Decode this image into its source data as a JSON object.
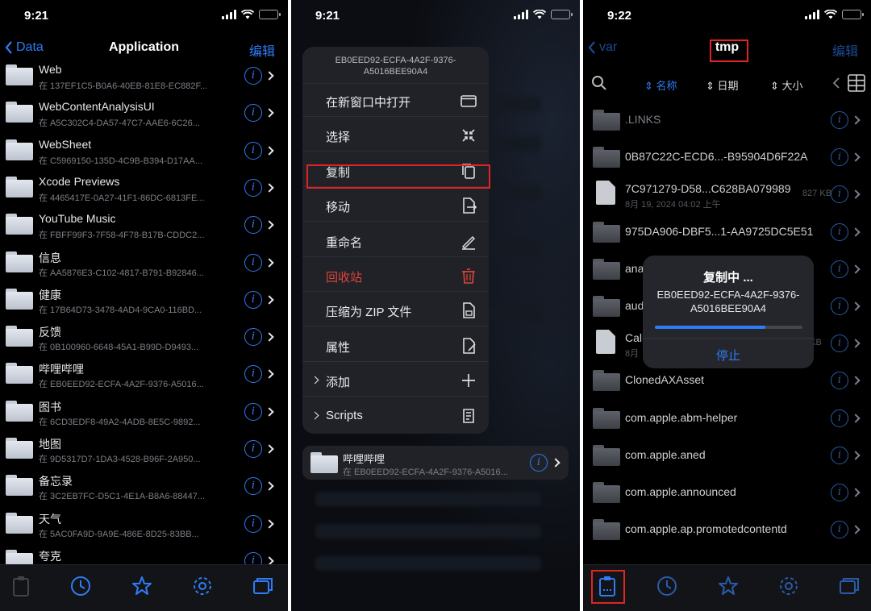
{
  "panel1": {
    "status": {
      "time": "9:21"
    },
    "nav": {
      "back_label": "Data",
      "title": "Application",
      "edit_label": "编辑"
    },
    "rows": [
      {
        "name": "Web",
        "sub": "在 137EF1C5-B0A6-40EB-81E8-EC882F..."
      },
      {
        "name": "WebContentAnalysisUI",
        "sub": "在 A5C302C4-DA57-47C7-AAE6-6C26..."
      },
      {
        "name": "WebSheet",
        "sub": "在 C5969150-135D-4C9B-B394-D17AA..."
      },
      {
        "name": "Xcode Previews",
        "sub": "在 4465417E-0A27-41F1-86DC-6813FE..."
      },
      {
        "name": "YouTube Music",
        "sub": "在 FBFF99F3-7F58-4F78-B17B-CDDC2..."
      },
      {
        "name": "信息",
        "sub": "在 AA5876E3-C102-4817-B791-B92846..."
      },
      {
        "name": "健康",
        "sub": "在 17B64D73-3478-4AD4-9CA0-116BD..."
      },
      {
        "name": "反馈",
        "sub": "在 0B100960-6648-45A1-B99D-D9493..."
      },
      {
        "name": "哔哩哔哩",
        "sub": "在 EB0EED92-ECFA-4A2F-9376-A5016..."
      },
      {
        "name": "图书",
        "sub": "在 6CD3EDF8-49A2-4ADB-8E5C-9892..."
      },
      {
        "name": "地图",
        "sub": "在 9D5317D7-1DA3-4528-B96F-2A950..."
      },
      {
        "name": "备忘录",
        "sub": "在 3C2EB7FC-D5C1-4E1A-B8A6-88447..."
      },
      {
        "name": "天气",
        "sub": "在 5AC0FA9D-9A9E-486E-8D25-83BB..."
      },
      {
        "name": "夸克",
        "sub": ""
      }
    ]
  },
  "panel2": {
    "status": {
      "time": "9:21"
    },
    "menu_header_line1": "EB0EED92-ECFA-4A2F-9376-",
    "menu_header_line2": "A5016BEE90A4",
    "menu_items": [
      {
        "label": "在新窗口中打开",
        "icon": "window-icon"
      },
      {
        "label": "选择",
        "icon": "select-icon"
      },
      {
        "label": "复制",
        "icon": "copy-icon"
      },
      {
        "label": "移动",
        "icon": "move-icon"
      },
      {
        "label": "重命名",
        "icon": "rename-icon"
      },
      {
        "label": "回收站",
        "icon": "trash-icon"
      },
      {
        "label": "压缩为 ZIP 文件",
        "icon": "zip-icon"
      },
      {
        "label": "属性",
        "icon": "properties-icon"
      },
      {
        "label": "添加",
        "icon": "plus-icon"
      },
      {
        "label": "Scripts",
        "icon": "scripts-icon"
      }
    ],
    "preview": {
      "name": "哔哩哔哩",
      "sub": "在 EB0EED92-ECFA-4A2F-9376-A5016..."
    }
  },
  "panel3": {
    "status": {
      "time": "9:22"
    },
    "nav": {
      "back_label": "var",
      "title": "tmp",
      "edit_label": "编辑"
    },
    "sort": {
      "name": "名称",
      "date": "日期",
      "size": "大小"
    },
    "rows": [
      {
        "name": ".LINKS",
        "sub": "",
        "size": "",
        "kind": "folder"
      },
      {
        "name": "0B87C22C-ECD6...-B95904D6F22A",
        "sub": "",
        "size": "",
        "kind": "folder"
      },
      {
        "name": "7C971279-D58...C628BA079989",
        "sub": "8月 19, 2024 04:02 上午",
        "size": "827 KB",
        "kind": "file"
      },
      {
        "name": "975DA906-DBF5...1-AA9725DC5E51",
        "sub": "",
        "size": "",
        "kind": "folder"
      },
      {
        "name": "ana",
        "sub": "",
        "size": "",
        "kind": "folder"
      },
      {
        "name": "aud",
        "sub": "",
        "size": "",
        "kind": "folder"
      },
      {
        "name": "Cali",
        "sub": "8月",
        "size": "0 KB",
        "kind": "file"
      },
      {
        "name": "ClonedAXAsset",
        "sub": "",
        "size": "",
        "kind": "folder"
      },
      {
        "name": "com.apple.abm-helper",
        "sub": "",
        "size": "",
        "kind": "folder"
      },
      {
        "name": "com.apple.aned",
        "sub": "",
        "size": "",
        "kind": "folder"
      },
      {
        "name": "com.apple.announced",
        "sub": "",
        "size": "",
        "kind": "folder"
      },
      {
        "name": "com.apple.ap.promotedcontentd",
        "sub": "",
        "size": "",
        "kind": "folder"
      }
    ],
    "dialog": {
      "title": "复制中 ...",
      "name_line1": "EB0EED92-ECFA-4A2F-9376-",
      "name_line2": "A5016BEE90A4",
      "progress": 0.75,
      "stop_label": "停止"
    }
  },
  "colors": {
    "accent": "#2f7cf6",
    "highlight": "#e02424",
    "destructive": "#e0453b"
  }
}
